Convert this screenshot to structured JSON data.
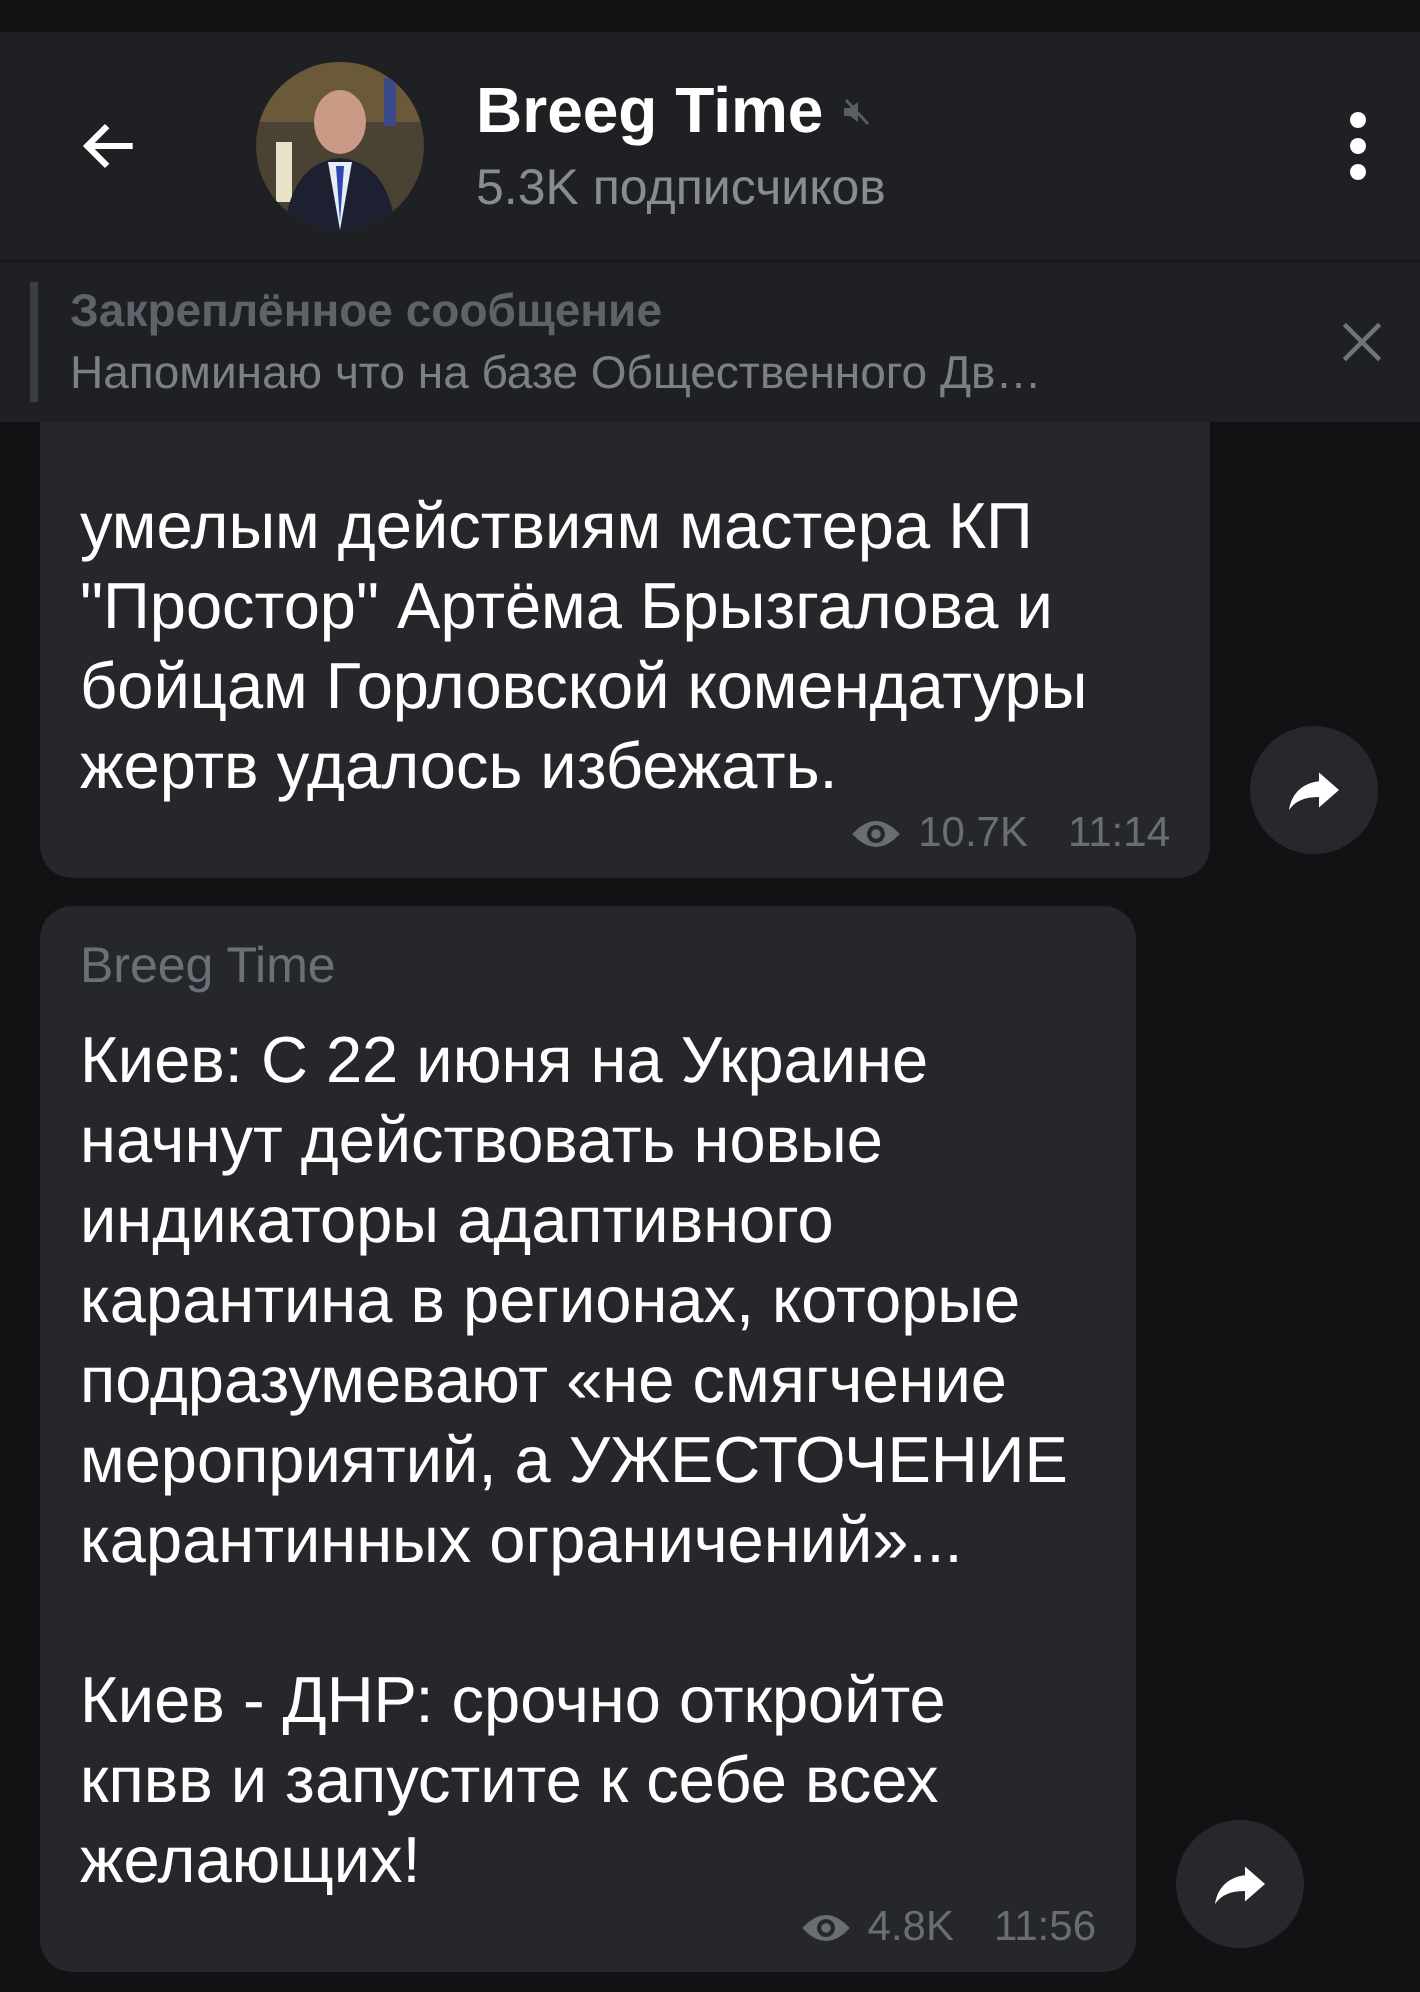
{
  "header": {
    "title": "Breeg Time",
    "muted": true,
    "subtitle": "5.3K подписчиков"
  },
  "pinned": {
    "label": "Закреплённое сообщение",
    "text": "Напоминаю что на базе Общественного Дв…"
  },
  "messages": [
    {
      "text": "умелым действиям мастера КП \"Простор\" Артёма Брызгалова и бойцам Горловской комендатуры жертв удалось избежать.",
      "views": "10.7K",
      "time": "11:14"
    },
    {
      "author": "Breeg Time",
      "text": "Киев: С 22 июня на Украине начнут действовать новые индикаторы адаптивного карантина в регионах, которые подразумевают «не смягчение мероприятий, а УЖЕСТОЧЕНИЕ карантинных ограничений»...\n\nКиев - ДНР: срочно откройте кпвв и запустите к себе всех желающих!",
      "views": "4.8K",
      "time": "11:56"
    }
  ]
}
